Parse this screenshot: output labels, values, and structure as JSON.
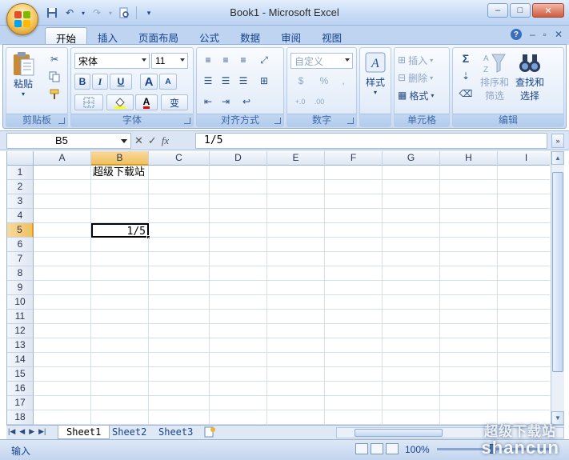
{
  "window": {
    "title": "Book1 - Microsoft Excel",
    "min_label": "–",
    "max_label": "□",
    "close_label": "✕"
  },
  "ribbon_tabs": [
    "开始",
    "插入",
    "页面布局",
    "公式",
    "数据",
    "审阅",
    "视图"
  ],
  "ribbon": {
    "clipboard": {
      "label": "剪贴板",
      "paste": "粘贴"
    },
    "font": {
      "label": "字体",
      "font_name": "宋体",
      "font_size": "11",
      "bold": "B",
      "italic": "I",
      "underline": "U",
      "grow": "A",
      "shrink": "A",
      "font_color_glyph": "A",
      "wen": "变"
    },
    "alignment": {
      "label": "对齐方式"
    },
    "number": {
      "label": "数字",
      "format": "自定义",
      "percent": "%",
      "comma": ",",
      "inc": "+.0",
      "dec": ".00"
    },
    "styles": {
      "label": "样式"
    },
    "cells": {
      "label": "单元格",
      "insert": "插入",
      "delete": "删除",
      "format": "格式"
    },
    "editing": {
      "label": "编辑",
      "sort_filter_1": "排序和",
      "sort_filter_2": "筛选",
      "find_select_1": "查找和",
      "find_select_2": "选择",
      "sum": "Σ"
    }
  },
  "formula_bar": {
    "name_box": "B5",
    "formula": "1/5",
    "fx": "fx"
  },
  "grid": {
    "columns": [
      "A",
      "B",
      "C",
      "D",
      "E",
      "F",
      "G",
      "H",
      "I"
    ],
    "rows": [
      "1",
      "2",
      "3",
      "4",
      "5",
      "6",
      "7",
      "8",
      "9",
      "10",
      "11",
      "12",
      "13",
      "14",
      "15",
      "16",
      "17",
      "18"
    ],
    "selected_column": "B",
    "selected_row": "5",
    "cells": {
      "B1": "超级下载站",
      "B5": "1/5"
    }
  },
  "sheets": [
    "Sheet1",
    "Sheet2",
    "Sheet3"
  ],
  "active_sheet": "Sheet1",
  "status": {
    "mode": "输入",
    "zoom": "100%"
  },
  "watermark": {
    "main": "shancun",
    "sub": "超级下载站"
  }
}
